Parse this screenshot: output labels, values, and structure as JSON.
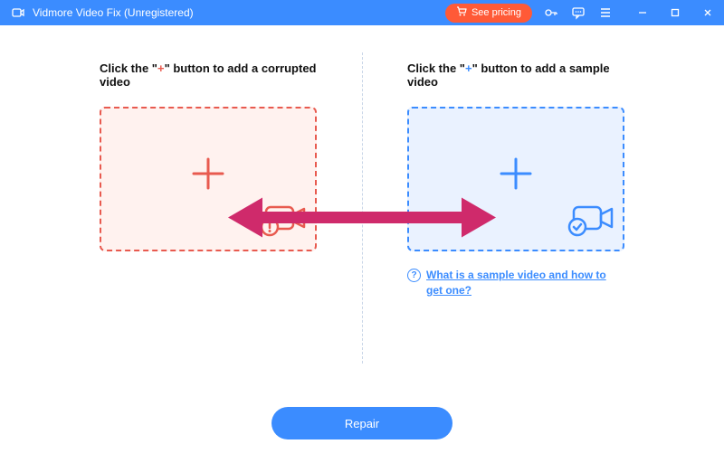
{
  "titlebar": {
    "app_title": "Vidmore Video Fix (Unregistered)",
    "see_pricing": "See pricing"
  },
  "left_panel": {
    "label_prefix": "Click the \"",
    "label_plus": "+",
    "label_suffix": "\" button to add a corrupted video"
  },
  "right_panel": {
    "label_prefix": "Click the \"",
    "label_plus": "+",
    "label_suffix": "\" button to add a sample video",
    "help_link": "What is a sample video and how to get one?",
    "help_q": "?"
  },
  "footer": {
    "repair": "Repair"
  },
  "colors": {
    "primary_blue": "#3b8cff",
    "accent_orange": "#e85a4f",
    "pricing_orange": "#ff5a37",
    "arrow_magenta": "#cf2a6b"
  }
}
